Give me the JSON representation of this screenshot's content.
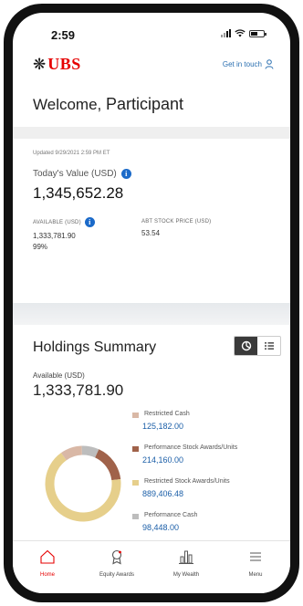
{
  "status_bar": {
    "time": "2:59"
  },
  "header": {
    "brand": "UBS",
    "get_in_touch": "Get in touch",
    "person_icon": "person-icon"
  },
  "welcome": {
    "greeting": "Welcome,",
    "name": "Participant"
  },
  "summary": {
    "updated": "Updated 9/29/2021 2:59 PM ET",
    "today_label": "Today's Value (USD)",
    "today_value": "1,345,652.28",
    "available_label": "AVAILABLE (USD)",
    "available_value": "1,333,781.90",
    "available_percent": "99%",
    "abt_label": "ABT STOCK PRICE (USD)",
    "abt_value": "53.54"
  },
  "holdings": {
    "title": "Holdings Summary",
    "available_label": "Available (USD)",
    "available_value": "1,333,781.90",
    "view_options": [
      "chart-view-icon",
      "list-view-icon"
    ],
    "legend": [
      {
        "label": "Restricted Cash",
        "value": "125,182.00",
        "color": "#d9b8a6"
      },
      {
        "label": "Performance Stock Awards/Units",
        "value": "214,160.00",
        "color": "#a0624a"
      },
      {
        "label": "Restricted Stock Awards/Units",
        "value": "889,406.48",
        "color": "#e6cf8b"
      },
      {
        "label": "Performance Cash",
        "value": "98,448.00",
        "color": "#bdbdbd"
      }
    ]
  },
  "chart_data": {
    "type": "pie",
    "categories": [
      "Restricted Cash",
      "Performance Stock Awards/Units",
      "Restricted Stock Awards/Units",
      "Performance Cash"
    ],
    "values": [
      125182.0,
      214160.0,
      889406.48,
      98448.0
    ],
    "colors": [
      "#d9b8a6",
      "#a0624a",
      "#e6cf8b",
      "#bdbdbd"
    ]
  },
  "tabbar": {
    "items": [
      {
        "label": "Home",
        "icon": "home-icon",
        "active": true
      },
      {
        "label": "Equity Awards",
        "icon": "award-icon",
        "active": false
      },
      {
        "label": "My Wealth",
        "icon": "bar-chart-icon",
        "active": false
      },
      {
        "label": "Menu",
        "icon": "menu-icon",
        "active": false
      }
    ]
  },
  "colors": {
    "brand_red": "#e60000",
    "link_blue": "#1c5fa8",
    "info_blue": "#1b6ac9"
  }
}
